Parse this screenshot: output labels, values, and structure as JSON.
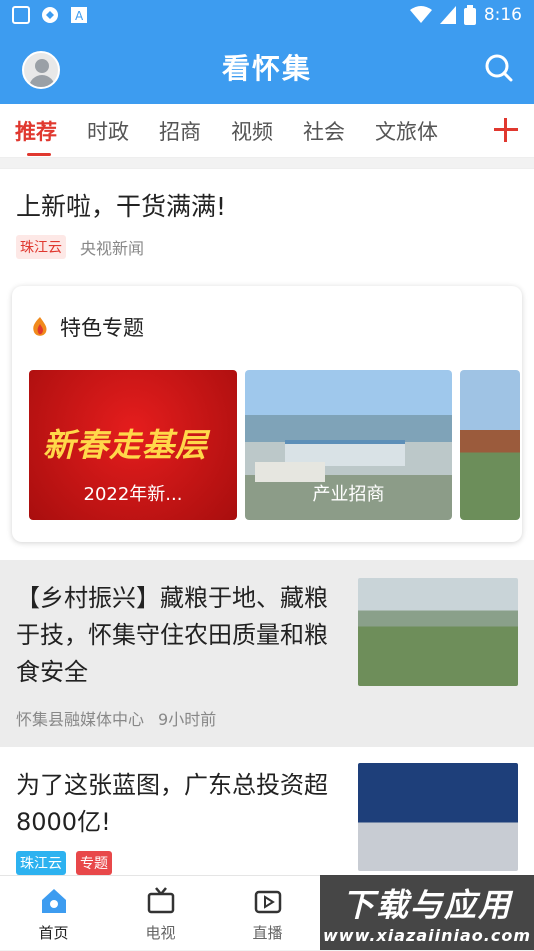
{
  "status_bar": {
    "time": "8:16",
    "icons": [
      "app-icon",
      "sync-icon",
      "a-icon",
      "wifi-icon",
      "signal-icon",
      "battery-icon"
    ]
  },
  "header": {
    "title": "看怀集",
    "avatar": "user-avatar",
    "search_icon": "search-icon"
  },
  "tabs": {
    "items": [
      {
        "label": "推荐",
        "active": true
      },
      {
        "label": "时政"
      },
      {
        "label": "招商"
      },
      {
        "label": "视频"
      },
      {
        "label": "社会"
      },
      {
        "label": "文旅体"
      }
    ],
    "add_icon": "plus-icon"
  },
  "news": [
    {
      "title": "上新啦，干货满满!",
      "tag": "珠江云",
      "source": "央视新闻"
    },
    {
      "title": "【乡村振兴】藏粮于地、藏粮于技，怀集守住农田质量和粮食安全",
      "source": "怀集县融媒体中心",
      "time": "9小时前"
    },
    {
      "title": "为了这张蓝图，广东总投资超8000亿!",
      "tags": [
        "珠江云",
        "专题"
      ]
    }
  ],
  "feature": {
    "title": "特色专题",
    "cards": [
      {
        "image_text": "新春走基层",
        "caption": "2022年新..."
      },
      {
        "caption": "产业招商"
      },
      {
        "caption": ""
      }
    ]
  },
  "tab_bar": {
    "items": [
      {
        "label": "首页",
        "icon": "home-icon",
        "active": true
      },
      {
        "label": "电视",
        "icon": "tv-icon"
      },
      {
        "label": "直播",
        "icon": "live-icon"
      }
    ]
  },
  "watermark": {
    "line1": "下载与应用",
    "line2": "www.xiazaiiniao.com"
  },
  "colors": {
    "header_bg": "#3d9cf0",
    "accent_red": "#e0382f",
    "tag_blue": "#2db2f0"
  }
}
